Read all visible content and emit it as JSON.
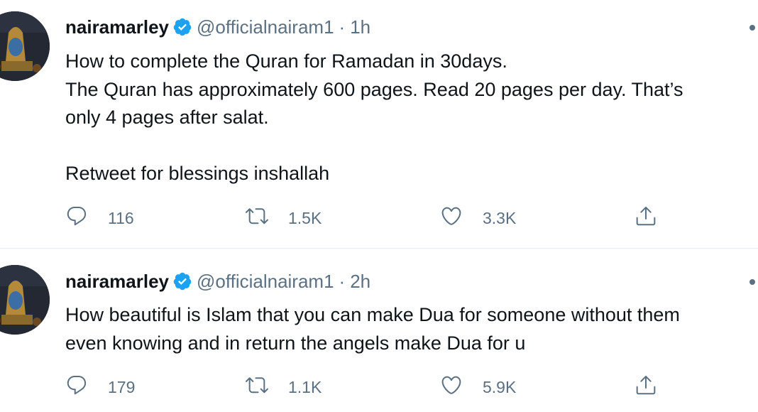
{
  "colors": {
    "text_primary": "#0f1419",
    "text_secondary": "#5b7083",
    "verified_blue": "#1da1f2",
    "divider": "#e6ecf0"
  },
  "tweets": [
    {
      "display_name": "nairamarley",
      "handle": "@officialnairam1",
      "separator": "·",
      "time": "1h",
      "verified": true,
      "lines": [
        "How to complete the Quran for Ramadan in 30days.",
        "The Quran has approximately 600 pages. Read 20 pages per day. That’s",
        "only 4 pages after salat.",
        "",
        "Retweet for blessings inshallah"
      ],
      "replies": "116",
      "retweets": "1.5K",
      "likes": "3.3K",
      "icons": [
        "reply-icon",
        "retweet-icon",
        "like-icon",
        "share-icon",
        "more-icon",
        "verified-badge-icon"
      ]
    },
    {
      "display_name": "nairamarley",
      "handle": "@officialnairam1",
      "separator": "·",
      "time": "2h",
      "verified": true,
      "lines": [
        "How beautiful is Islam that you can make Dua for someone without them",
        "even knowing and in return the angels make Dua for u"
      ],
      "replies": "179",
      "retweets": "1.1K",
      "likes": "5.9K",
      "icons": [
        "reply-icon",
        "retweet-icon",
        "like-icon",
        "share-icon",
        "more-icon",
        "verified-badge-icon"
      ]
    }
  ]
}
